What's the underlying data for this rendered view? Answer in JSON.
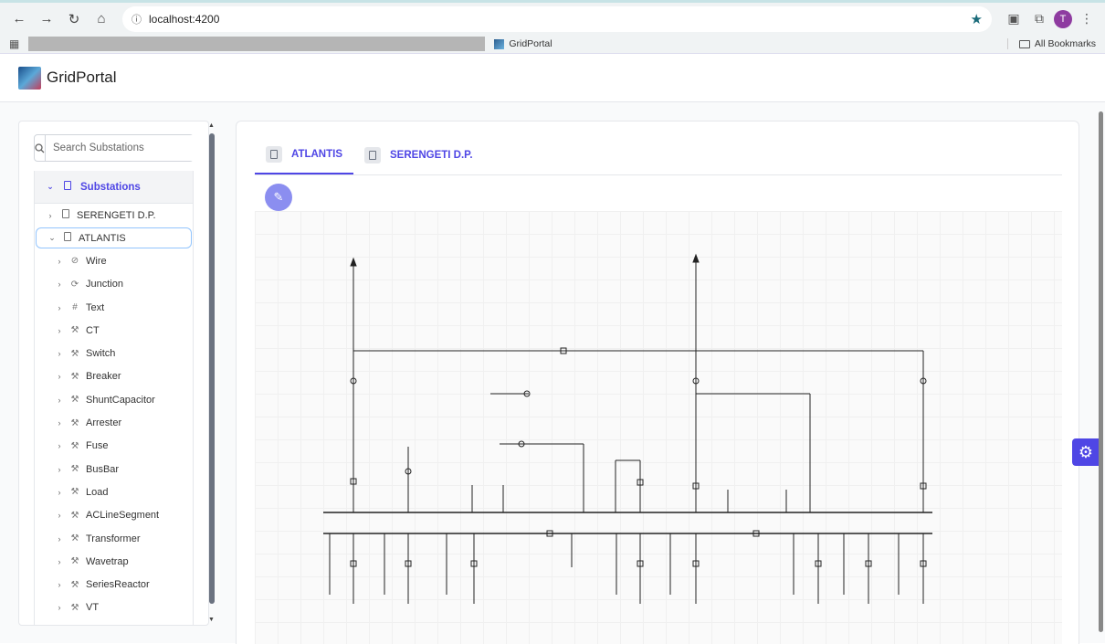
{
  "browser": {
    "url": "localhost:4200",
    "bookmark_label": "GridPortal",
    "all_bookmarks": "All Bookmarks",
    "avatar_letter": "T"
  },
  "app": {
    "title": "GridPortal"
  },
  "search": {
    "placeholder": "Search Substations"
  },
  "tree": {
    "root_label": "Substations",
    "substations": [
      {
        "label": "SERENGETI D.P.",
        "expanded": false
      },
      {
        "label": "ATLANTIS",
        "expanded": true,
        "selected": true
      }
    ],
    "children": [
      {
        "label": "Wire",
        "icon": "link-icon"
      },
      {
        "label": "Junction",
        "icon": "refresh-icon"
      },
      {
        "label": "Text",
        "icon": "hash-icon"
      },
      {
        "label": "CT",
        "icon": "wrench-icon"
      },
      {
        "label": "Switch",
        "icon": "wrench-icon"
      },
      {
        "label": "Breaker",
        "icon": "wrench-icon"
      },
      {
        "label": "ShuntCapacitor",
        "icon": "wrench-icon"
      },
      {
        "label": "Arrester",
        "icon": "wrench-icon"
      },
      {
        "label": "Fuse",
        "icon": "wrench-icon"
      },
      {
        "label": "BusBar",
        "icon": "wrench-icon"
      },
      {
        "label": "Load",
        "icon": "wrench-icon"
      },
      {
        "label": "ACLineSegment",
        "icon": "wrench-icon"
      },
      {
        "label": "Transformer",
        "icon": "wrench-icon"
      },
      {
        "label": "Wavetrap",
        "icon": "wrench-icon"
      },
      {
        "label": "SeriesReactor",
        "icon": "wrench-icon"
      },
      {
        "label": "VT",
        "icon": "wrench-icon"
      }
    ]
  },
  "tabs": [
    {
      "label": "ATLANTIS",
      "active": true
    },
    {
      "label": "SERENGETI D.P.",
      "active": false
    }
  ],
  "colors": {
    "accent": "#4f46e5",
    "fab": "#8b8ef0"
  }
}
